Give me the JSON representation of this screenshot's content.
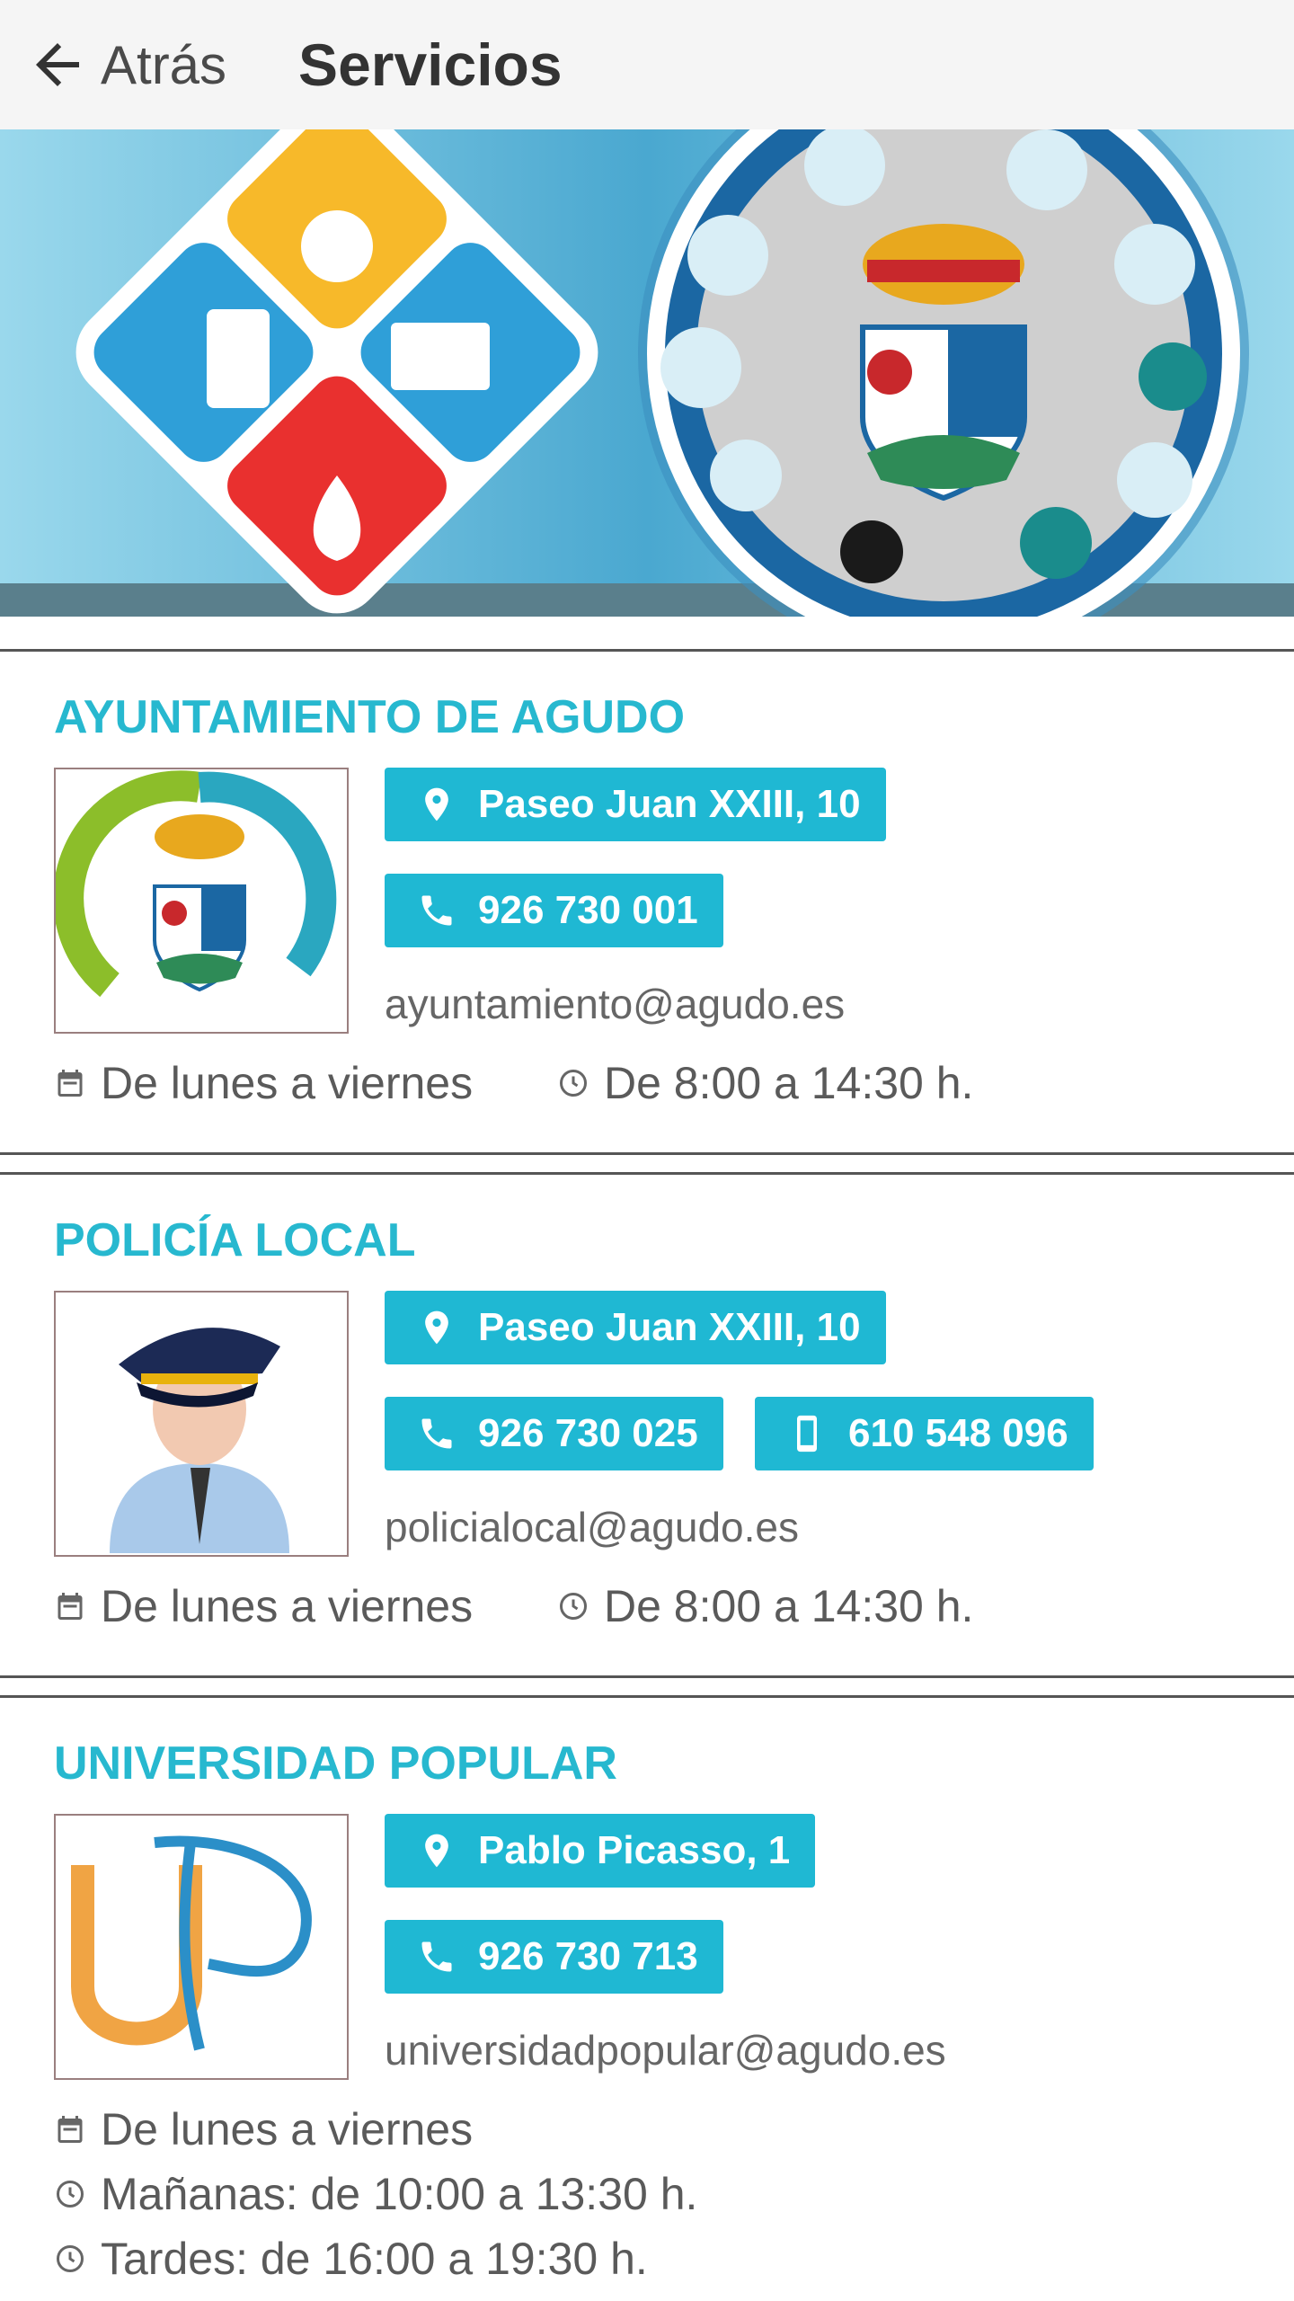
{
  "header": {
    "back_label": "Atrás",
    "title": "Servicios"
  },
  "services": [
    {
      "title": "AYUNTAMIENTO DE AGUDO",
      "address": "Paseo Juan XXIII, 10",
      "phone": "926 730 001",
      "email": "ayuntamiento@agudo.es",
      "days": "De lunes a viernes",
      "hours": "De 8:00 a 14:30 h."
    },
    {
      "title": "POLICÍA LOCAL",
      "address": "Paseo Juan XXIII, 10",
      "phone": "926 730 025",
      "mobile": "610 548 096",
      "email": "policialocal@agudo.es",
      "days": "De lunes a viernes",
      "hours": "De 8:00 a 14:30 h."
    },
    {
      "title": "UNIVERSIDAD POPULAR",
      "address": "Pablo Picasso, 1",
      "phone": "926 730 713",
      "email": "universidadpopular@agudo.es",
      "days": "De lunes a viernes",
      "hours_morning": "Mañanas: de 10:00 a 13:30 h.",
      "hours_afternoon": "Tardes: de 16:00 a 19:30 h."
    }
  ],
  "colors": {
    "accent": "#1fb8d3",
    "title": "#27b8cf"
  }
}
